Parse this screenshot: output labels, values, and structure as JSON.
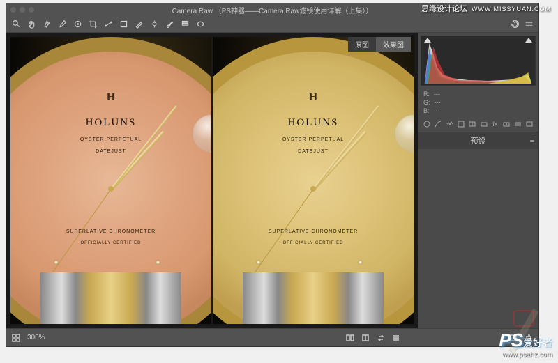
{
  "window": {
    "title": "Camera Raw （PS神器——Camera Raw滤镜使用详解（上集））"
  },
  "preview_tabs": {
    "original": "原图",
    "effect": "效果图"
  },
  "watch_text": {
    "logo": "H",
    "brand": "HOLUNS",
    "line1": "Oyster Perpetual",
    "line2": "Datejust",
    "line3": "Superlative Chronometer",
    "line4": "Officially Certified"
  },
  "rgb": {
    "r_label": "R:",
    "r_val": "---",
    "g_label": "G:",
    "g_val": "---",
    "b_label": "B:",
    "b_val": "---"
  },
  "panel": {
    "title": "预设"
  },
  "status": {
    "zoom": "300%"
  },
  "watermark": {
    "top_text": "思缘设计论坛",
    "top_url": "WWW.MISSYUAN.COM",
    "ps": "PS",
    "ahz": "爱好者",
    "bottom_url": "www.psahz.com"
  }
}
